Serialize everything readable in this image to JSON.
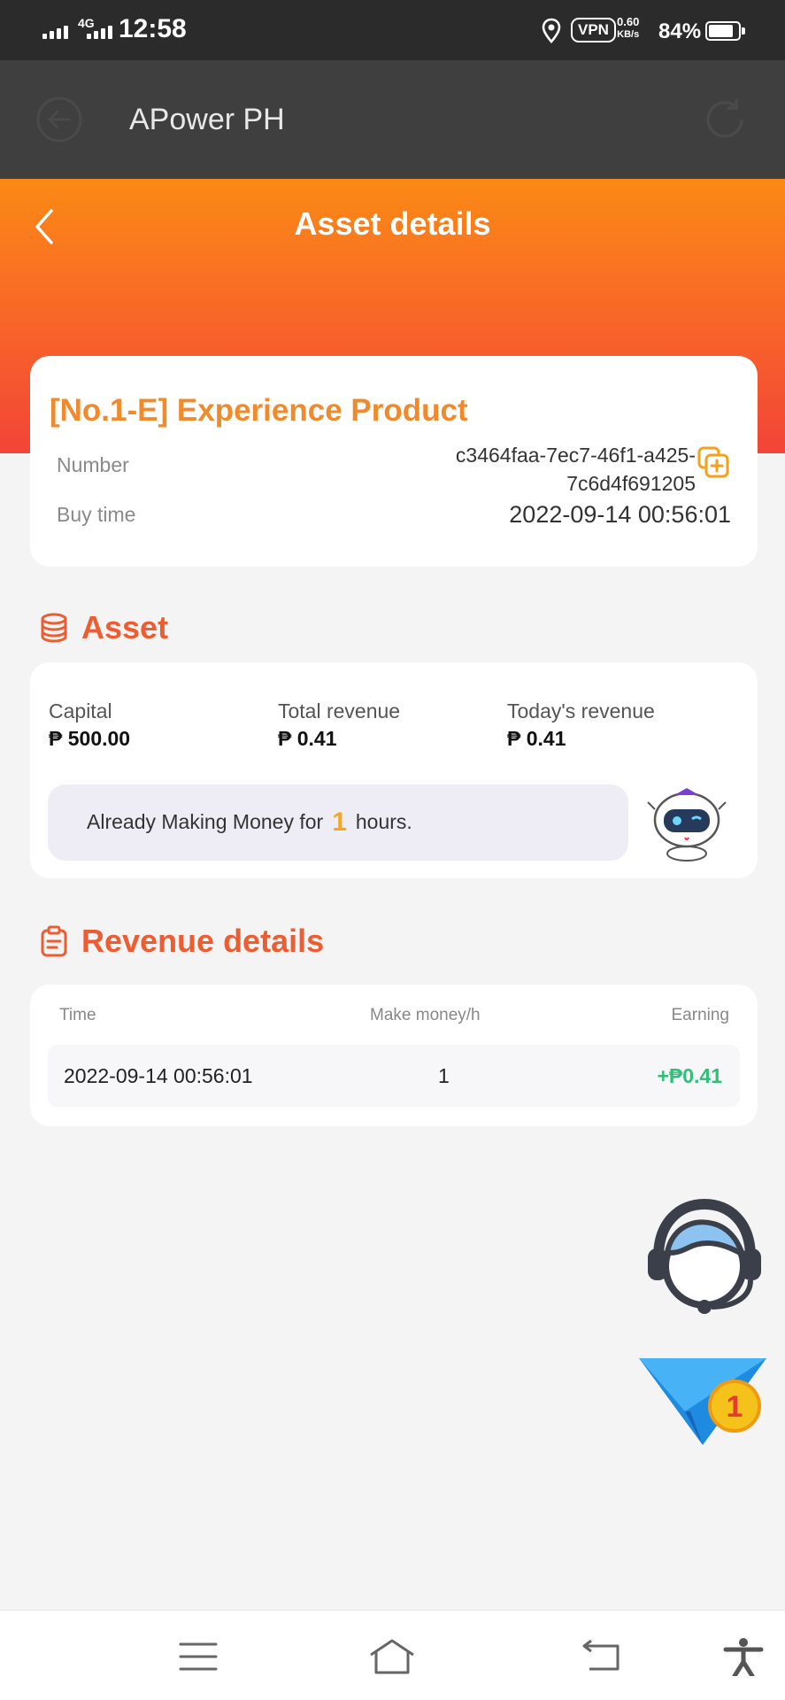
{
  "status_bar": {
    "network": "4G",
    "time": "12:58",
    "vpn": "VPN",
    "speed_value": "0.60",
    "speed_unit": "KB/s",
    "battery": "84%"
  },
  "app_bar": {
    "title": "APower PH",
    "back_icon": "back-circle-icon",
    "refresh_icon": "refresh-icon"
  },
  "page": {
    "title": "Asset details"
  },
  "product": {
    "name": "[No.1-E] Experience Product",
    "number_label": "Number",
    "number_line1": "c3464faa-7ec7-46f1-a425-",
    "number_line2": "7c6d4f691205",
    "buy_time_label": "Buy time",
    "buy_time": "2022-09-14 00:56:01"
  },
  "asset": {
    "section_title": "Asset",
    "capital_label": "Capital",
    "capital_value": "₱ 500.00",
    "total_revenue_label": "Total revenue",
    "total_revenue_value": "₱ 0.41",
    "today_revenue_label": "Today's revenue",
    "today_revenue_value": "₱ 0.41",
    "making_prefix": "Already Making Money for",
    "making_hours": "1",
    "making_suffix": "hours."
  },
  "revenue": {
    "section_title": "Revenue details",
    "columns": [
      "Time",
      "Make money/h",
      "Earning"
    ],
    "rows": [
      {
        "time": "2022-09-14 00:56:01",
        "make_money": "1",
        "earning": "+₱0.41"
      }
    ]
  },
  "floating": {
    "service_icon": "customer-service-icon",
    "plane_icon": "paper-plane-icon",
    "plane_badge": "1"
  },
  "colors": {
    "accent_orange": "#f08a2a",
    "section_red": "#ee5c32",
    "earning_green": "#2fc078"
  }
}
